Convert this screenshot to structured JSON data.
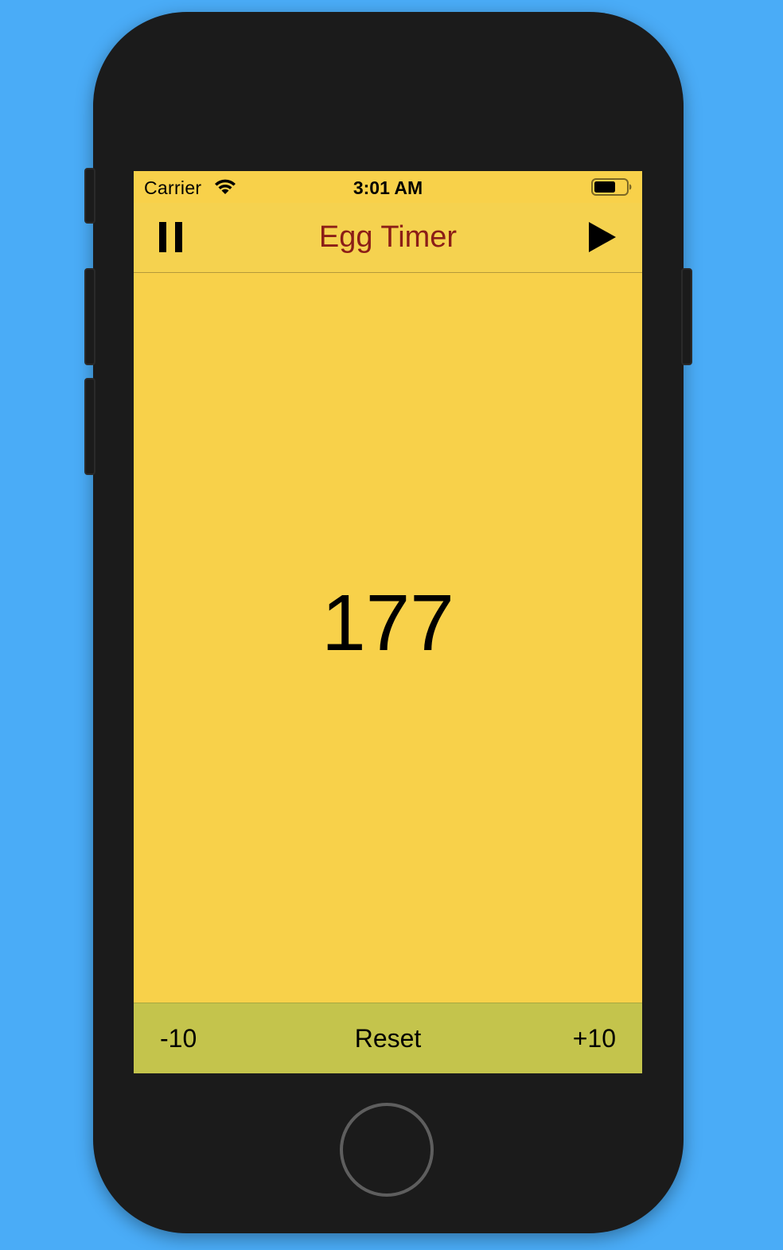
{
  "status_bar": {
    "carrier": "Carrier",
    "time": "3:01 AM",
    "wifi_icon": "wifi-icon",
    "battery_icon": "battery-icon"
  },
  "nav_bar": {
    "title": "Egg Timer",
    "left_icon": "pause-icon",
    "right_icon": "play-icon"
  },
  "timer": {
    "value": "177"
  },
  "toolbar": {
    "minus_label": "-10",
    "reset_label": "Reset",
    "plus_label": "+10"
  },
  "colors": {
    "background": "#4aacf7",
    "screen": "#f8d14a",
    "nav_bar": "#f5d24f",
    "title": "#8b1d17",
    "toolbar": "#c4c44c",
    "device": "#1b1b1b"
  }
}
